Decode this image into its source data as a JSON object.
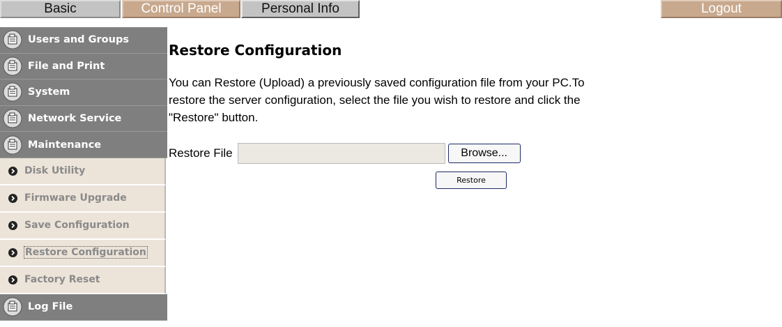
{
  "tabs": {
    "basic": "Basic",
    "control_panel": "Control Panel",
    "personal_info": "Personal Info",
    "logout": "Logout"
  },
  "sidebar": {
    "main_items": [
      {
        "label": "Users and Groups",
        "icon": "folder-icon"
      },
      {
        "label": "File and Print",
        "icon": "folder-icon"
      },
      {
        "label": "System",
        "icon": "folder-icon"
      },
      {
        "label": "Network Service",
        "icon": "folder-icon"
      },
      {
        "label": "Maintenance",
        "icon": "folder-icon"
      }
    ],
    "sub_items": [
      {
        "label": "Disk Utility"
      },
      {
        "label": "Firmware Upgrade"
      },
      {
        "label": "Save Configuration"
      },
      {
        "label": "Restore Configuration",
        "active": true
      },
      {
        "label": "Factory Reset"
      }
    ],
    "bottom_item": {
      "label": "Log File",
      "icon": "folder-icon"
    }
  },
  "main": {
    "title": "Restore Configuration",
    "description_lines": [
      "You can Restore (Upload) a previously saved configuration file from your PC.To",
      "restore the server configuration, select the file you wish to restore and click the",
      "\"Restore\" button."
    ],
    "restore_file_label": "Restore File",
    "file_value": "",
    "browse_label": "Browse...",
    "restore_button": "Restore"
  },
  "colors": {
    "tab_gray": "#c3c3c3",
    "tab_tan": "#c8a98e",
    "sidebar_main": "#7f7f7f",
    "sidebar_sub": "#ece3d9"
  }
}
